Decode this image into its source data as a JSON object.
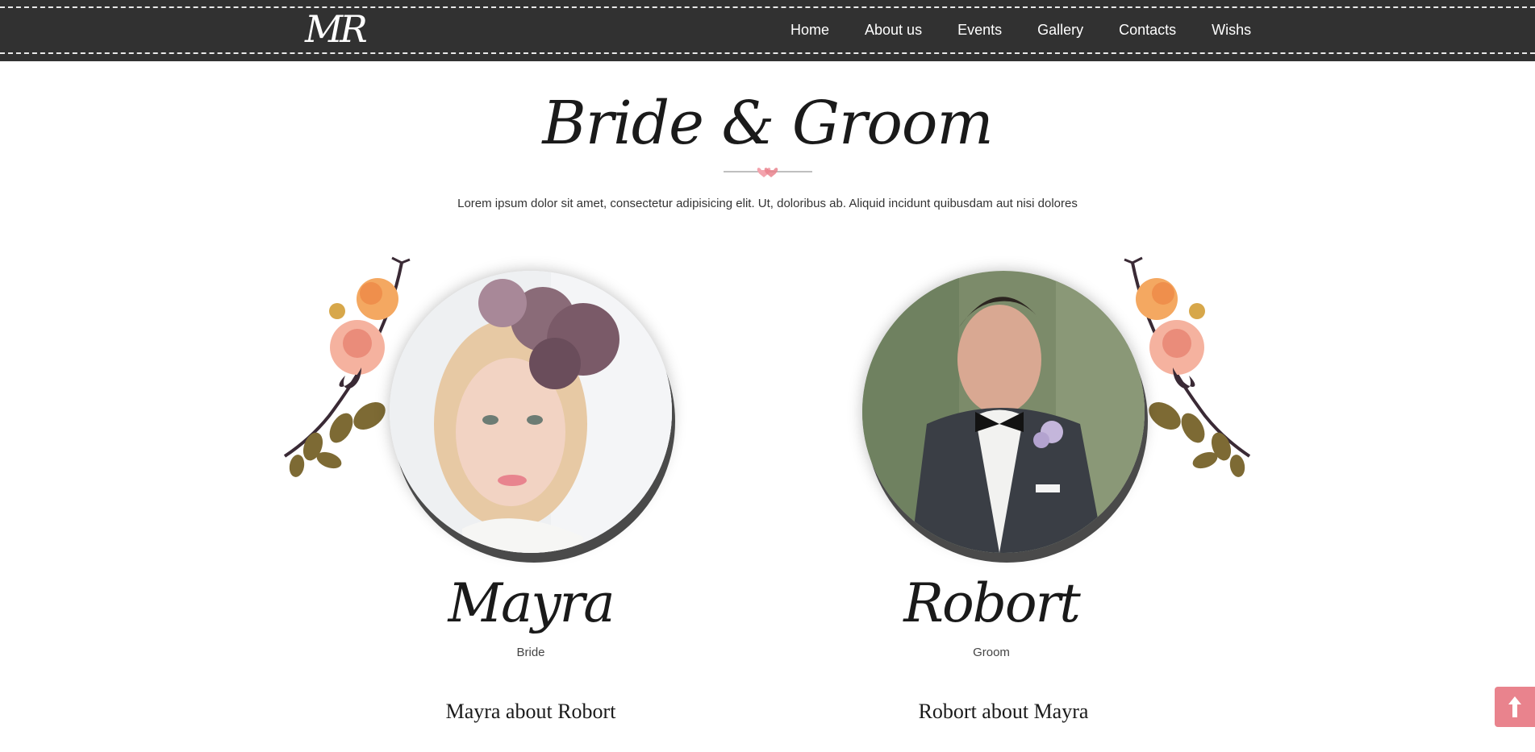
{
  "header": {
    "logo": "MR",
    "nav": [
      "Home",
      "About us",
      "Events",
      "Gallery",
      "Contacts",
      "Wishs"
    ]
  },
  "section": {
    "title": "Bride & Groom",
    "intro": "Lorem ipsum dolor sit amet, consectetur adipisicing elit. Ut, doloribus ab. Aliquid incidunt quibusdam aut nisi dolores"
  },
  "bride": {
    "name": "Mayra",
    "role": "Bride",
    "about_heading": "Mayra about Robort"
  },
  "groom": {
    "name": "Robort",
    "role": "Groom",
    "about_heading": "Robort about Mayra"
  },
  "scroll_top_icon": "arrow-up-icon",
  "colors": {
    "navbar": "#313131",
    "accent_pink": "#e9838d",
    "text_dark": "#1a1a1a"
  }
}
